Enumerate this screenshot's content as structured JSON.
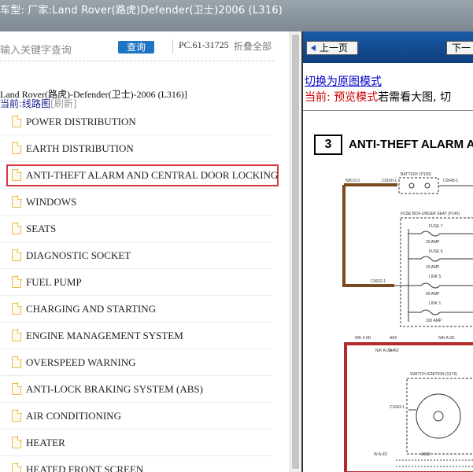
{
  "header": {
    "title": "车型:  厂家:Land Rover(路虎)Defender(卫士)2006 (L316)"
  },
  "search": {
    "placeholder": "输入关键字查询",
    "query_label": "查询",
    "pc_code": "PC.61-31725",
    "collapse_label": "折叠全部"
  },
  "breadcrumb": {
    "path": "Land Rover(路虎)-Defender(卫士)-2006 (L316)]",
    "current_label": "当前:",
    "current_value": "线路图",
    "refresh_label": "[刷新]"
  },
  "tree": {
    "items": [
      {
        "label": "POWER DISTRIBUTION",
        "active": false
      },
      {
        "label": "EARTH DISTRIBUTION",
        "active": false
      },
      {
        "label": "ANTI-THEFT ALARM AND CENTRAL DOOR LOCKING",
        "active": true
      },
      {
        "label": "WINDOWS",
        "active": false
      },
      {
        "label": "SEATS",
        "active": false
      },
      {
        "label": "DIAGNOSTIC SOCKET",
        "active": false
      },
      {
        "label": "FUEL PUMP",
        "active": false
      },
      {
        "label": "CHARGING AND STARTING",
        "active": false
      },
      {
        "label": "ENGINE MANAGEMENT SYSTEM",
        "active": false
      },
      {
        "label": "OVERSPEED WARNING",
        "active": false
      },
      {
        "label": "ANTI-LOCK BRAKING SYSTEM (ABS)",
        "active": false
      },
      {
        "label": "AIR CONDITIONING",
        "active": false
      },
      {
        "label": "HEATER",
        "active": false
      },
      {
        "label": "HEATED FRONT SCREEN",
        "active": false
      }
    ]
  },
  "viewer": {
    "prev_label": "上一页",
    "next_label": "下一",
    "switch_link": "切换为原图模式",
    "mode_red": "当前: 预览模式",
    "mode_black": "若需看大图, 切"
  },
  "diagram": {
    "number": "3",
    "title": "ANTI-THEFT ALARM A",
    "labels": {
      "battery": "BATTERY (P100)",
      "fusebox": "FUSE BOX-UNDER SEAT (P140)",
      "fuse7": "FUSE 7",
      "amp20": "20 AMP",
      "fuse6": "FUSE 6",
      "amp15": "15 AMP",
      "link5": "LINK 5",
      "amp60": "60 AMP",
      "link1": "LINK 1",
      "amp100": "100 AMP",
      "switch": "SWITCH-IGNITION (S176)",
      "n100": "N/K10.0",
      "c0160": "C0160-1",
      "c0045": "C0045-1",
      "c0632": "C0632-1",
      "c1043": "C1043-1",
      "a64": "A64",
      "a462": "A462",
      "a362": "A362",
      "nk40": "N/K 4.0D",
      "nka": "N/K A.0D",
      "wa": "W A.0D",
      "nka2": "N/K A.0D"
    },
    "colors": {
      "brown": "#7a4a1e",
      "red": "#b22a2a",
      "dashed": "#333333"
    }
  }
}
